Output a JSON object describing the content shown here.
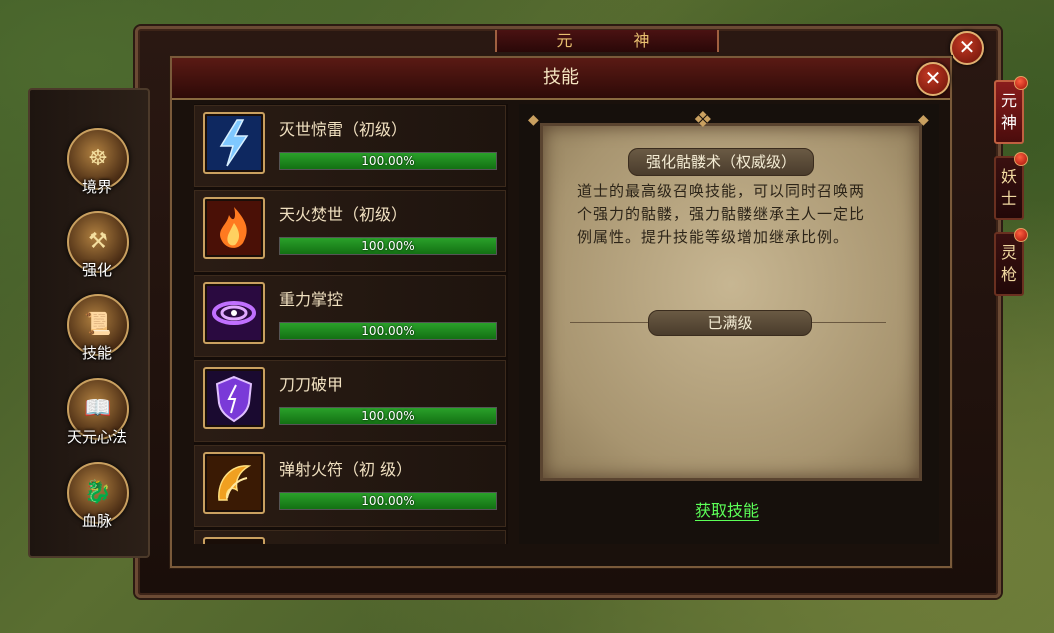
{
  "outer_window": {
    "title": "元 神",
    "close_icon": "close-icon"
  },
  "left_nav": [
    {
      "label": "境界",
      "icon": "meditation-icon"
    },
    {
      "label": "强化",
      "icon": "hammer-anvil-icon"
    },
    {
      "label": "技能",
      "icon": "scroll-icon"
    },
    {
      "label": "天元心法",
      "icon": "book-icon"
    },
    {
      "label": "血脉",
      "icon": "dragon-icon"
    }
  ],
  "right_tabs": [
    {
      "label": "元神",
      "active": true
    },
    {
      "label": "妖士",
      "active": false
    },
    {
      "label": "灵枪",
      "active": false
    }
  ],
  "skills_panel": {
    "title": "技能",
    "close_icon": "close-icon"
  },
  "skills": [
    {
      "name": "灭世惊雷（初级）",
      "progress_text": "100.00%",
      "progress": 1.0,
      "icon": "lightning-icon",
      "icon_color": "#3a8aff"
    },
    {
      "name": "天火焚世（初级）",
      "progress_text": "100.00%",
      "progress": 1.0,
      "icon": "fire-icon",
      "icon_color": "#ff6a20"
    },
    {
      "name": "重力掌控",
      "progress_text": "100.00%",
      "progress": 1.0,
      "icon": "vortex-icon",
      "icon_color": "#b050e0"
    },
    {
      "name": "刀刀破甲",
      "progress_text": "100.00%",
      "progress": 1.0,
      "icon": "shield-icon",
      "icon_color": "#9a50f0"
    },
    {
      "name": "弹射火符（初 级）",
      "progress_text": "100.00%",
      "progress": 1.0,
      "icon": "fire-talisman-icon",
      "icon_color": "#f0a020"
    }
  ],
  "detail": {
    "skill_title": "强化骷髅术（权威级）",
    "description": "道士的最高级召唤技能，可以同时召唤两个强力的骷髅，强力骷髅继承主人一定比例属性。提升技能等级增加继承比例。",
    "status": "已满级",
    "acquire_link": "获取技能"
  }
}
